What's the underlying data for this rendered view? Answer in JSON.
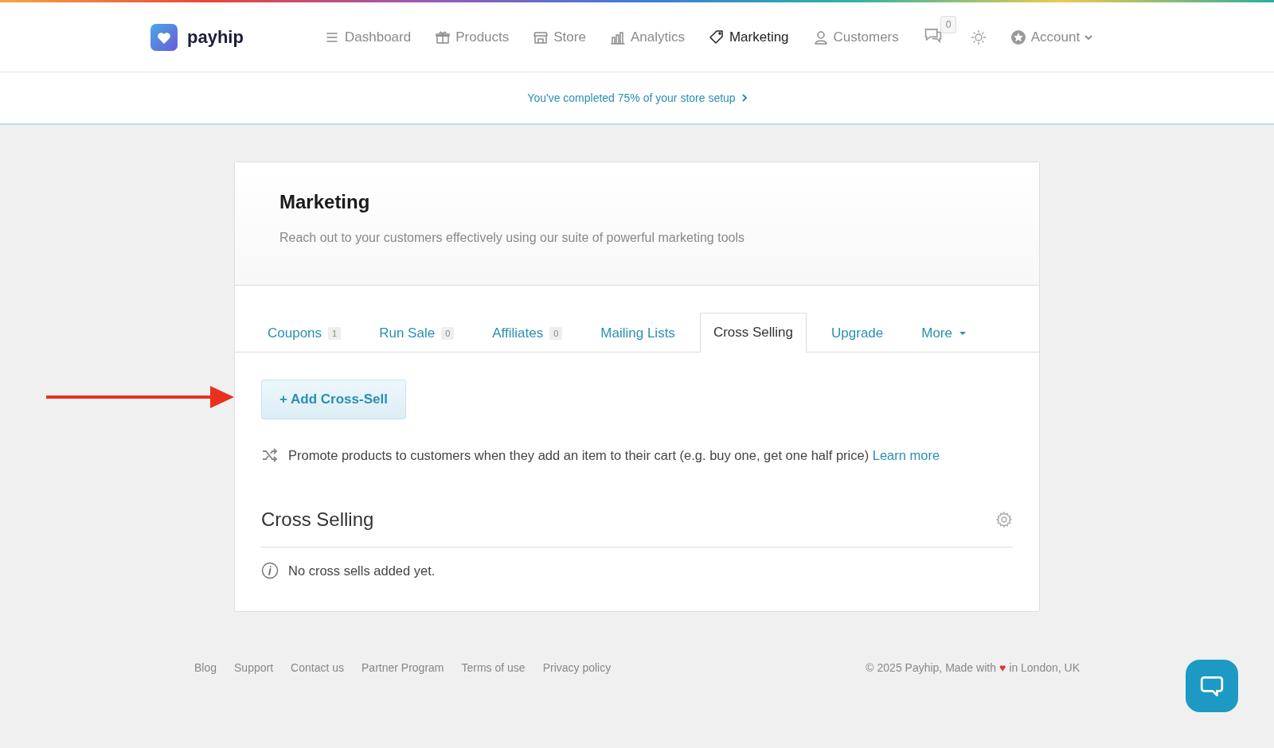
{
  "brand": {
    "name": "payhip"
  },
  "nav": [
    {
      "label": "Dashboard",
      "selected": false
    },
    {
      "label": "Products",
      "selected": false
    },
    {
      "label": "Store",
      "selected": false
    },
    {
      "label": "Analytics",
      "selected": false
    },
    {
      "label": "Marketing",
      "selected": true
    },
    {
      "label": "Customers",
      "selected": false
    }
  ],
  "messages": {
    "count": "0"
  },
  "account": {
    "label": "Account"
  },
  "setup_banner": {
    "text": "You've completed 75% of your store setup"
  },
  "page": {
    "title": "Marketing",
    "subtitle": "Reach out to your customers effectively using our suite of powerful marketing tools"
  },
  "tabs": [
    {
      "label": "Coupons",
      "count": "1",
      "selected": false,
      "kind": "plain"
    },
    {
      "label": "Run Sale",
      "count": "0",
      "selected": false,
      "kind": "plain"
    },
    {
      "label": "Affiliates",
      "count": "0",
      "selected": false,
      "kind": "plain"
    },
    {
      "label": "Mailing Lists",
      "selected": false,
      "kind": "plain"
    },
    {
      "label": "Cross Selling",
      "selected": true,
      "kind": "plain"
    },
    {
      "label": "Upgrade",
      "selected": false,
      "kind": "plain"
    },
    {
      "label": "More",
      "selected": false,
      "kind": "dropdown"
    }
  ],
  "add_button": {
    "label": "+ Add Cross-Sell"
  },
  "info": {
    "text": "Promote products to customers when they add an item to their cart (e.g. buy one, get one half price)",
    "link": "Learn more"
  },
  "section": {
    "title": "Cross Selling",
    "empty_message": "No cross sells added yet."
  },
  "footer": {
    "links": [
      "Blog",
      "Support",
      "Contact us",
      "Partner Program",
      "Terms of use",
      "Privacy policy"
    ],
    "copyright": "© 2025 Payhip, Made with",
    "heart": "♥",
    "location": "in London, UK"
  }
}
